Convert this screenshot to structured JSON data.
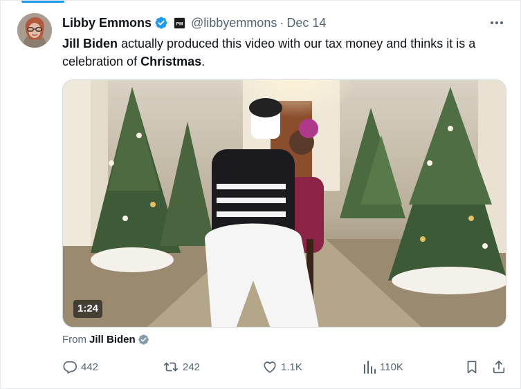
{
  "post": {
    "author_name": "Libby Emmons",
    "author_handle": "@libbyemmons",
    "separator": "·",
    "date": "Dec 14",
    "text": {
      "part1_bold": "Jill Biden",
      "part2": " actually produced this video with our tax money and thinks it is a celebration of ",
      "part3_bold": "Christmas",
      "part4": "."
    },
    "affiliation_badge_text": "PM"
  },
  "video": {
    "duration": "1:24"
  },
  "source": {
    "prefix": "From",
    "name": "Jill Biden"
  },
  "actions": {
    "replies": "442",
    "reposts": "242",
    "likes": "1.1K",
    "views": "110K"
  },
  "icons": {
    "verified": "verified-badge-icon",
    "affiliation": "affiliation-badge-icon",
    "more": "more-icon",
    "reply": "reply-icon",
    "repost": "repost-icon",
    "like": "heart-icon",
    "views": "views-icon",
    "bookmark": "bookmark-icon",
    "share": "share-icon",
    "gov_badge": "gray-verified-badge-icon"
  },
  "colors": {
    "accent": "#1d9bf0",
    "text_primary": "#0f1419",
    "text_secondary": "#536471",
    "gov_badge": "#829aab"
  }
}
